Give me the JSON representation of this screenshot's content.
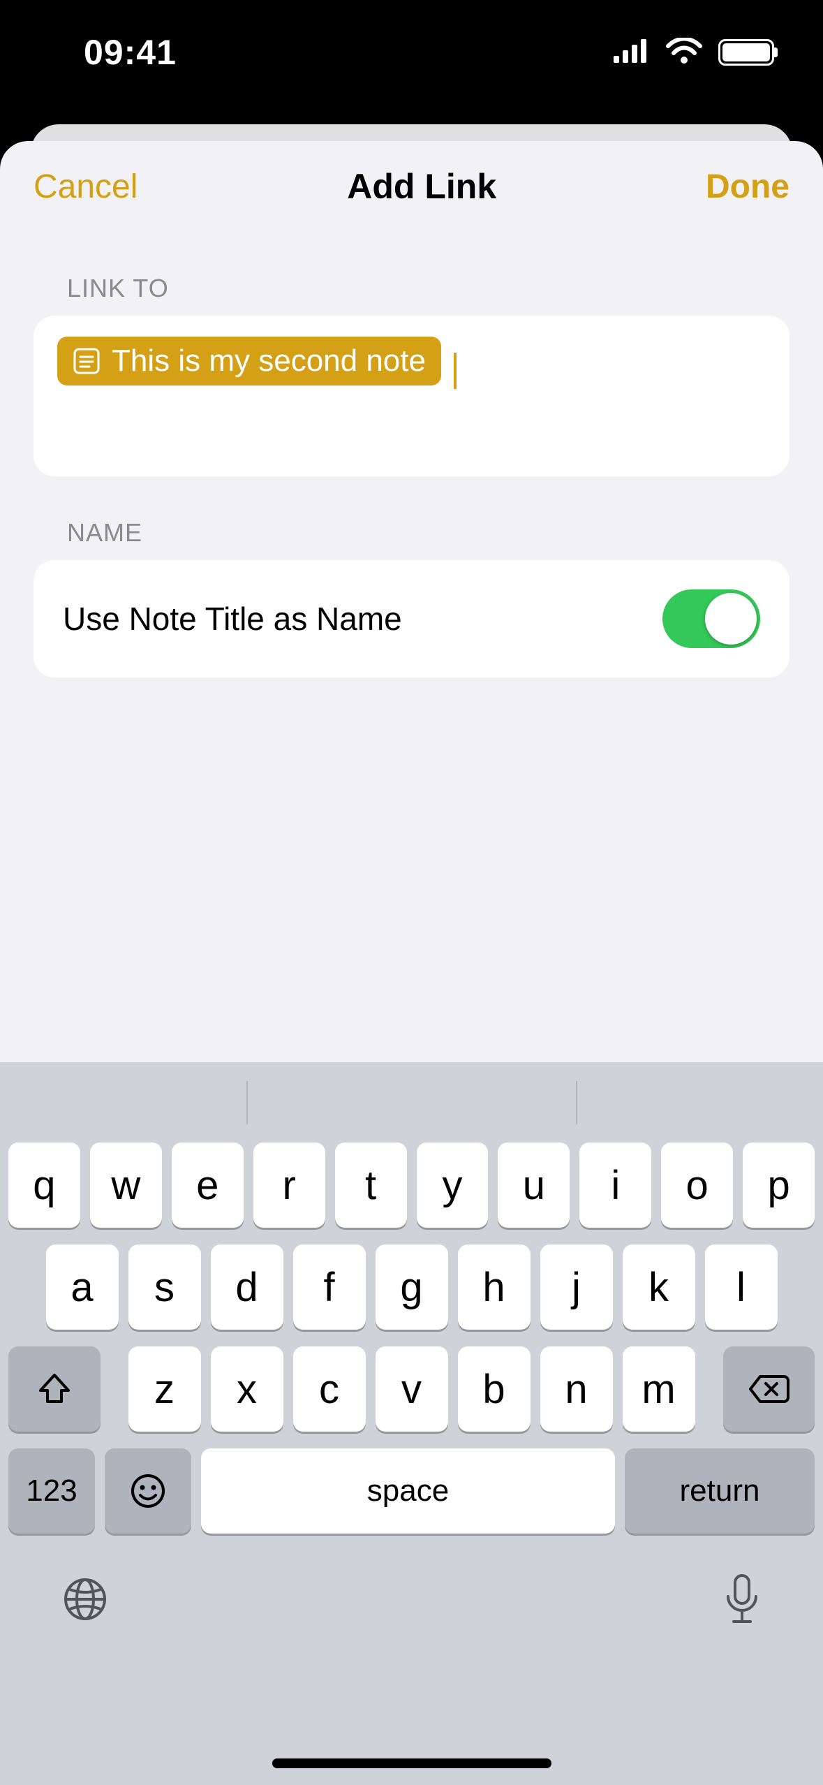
{
  "status": {
    "time": "09:41"
  },
  "nav": {
    "cancel": "Cancel",
    "title": "Add Link",
    "done": "Done"
  },
  "sections": {
    "linkto": {
      "header": "LINK TO",
      "chip": "This is my second note"
    },
    "name": {
      "header": "NAME",
      "label": "Use Note Title as Name",
      "toggle_on": true
    }
  },
  "keyboard": {
    "row1": [
      "q",
      "w",
      "e",
      "r",
      "t",
      "y",
      "u",
      "i",
      "o",
      "p"
    ],
    "row2": [
      "a",
      "s",
      "d",
      "f",
      "g",
      "h",
      "j",
      "k",
      "l"
    ],
    "row3": [
      "z",
      "x",
      "c",
      "v",
      "b",
      "n",
      "m"
    ],
    "numKey": "123",
    "space": "space",
    "return": "return"
  }
}
